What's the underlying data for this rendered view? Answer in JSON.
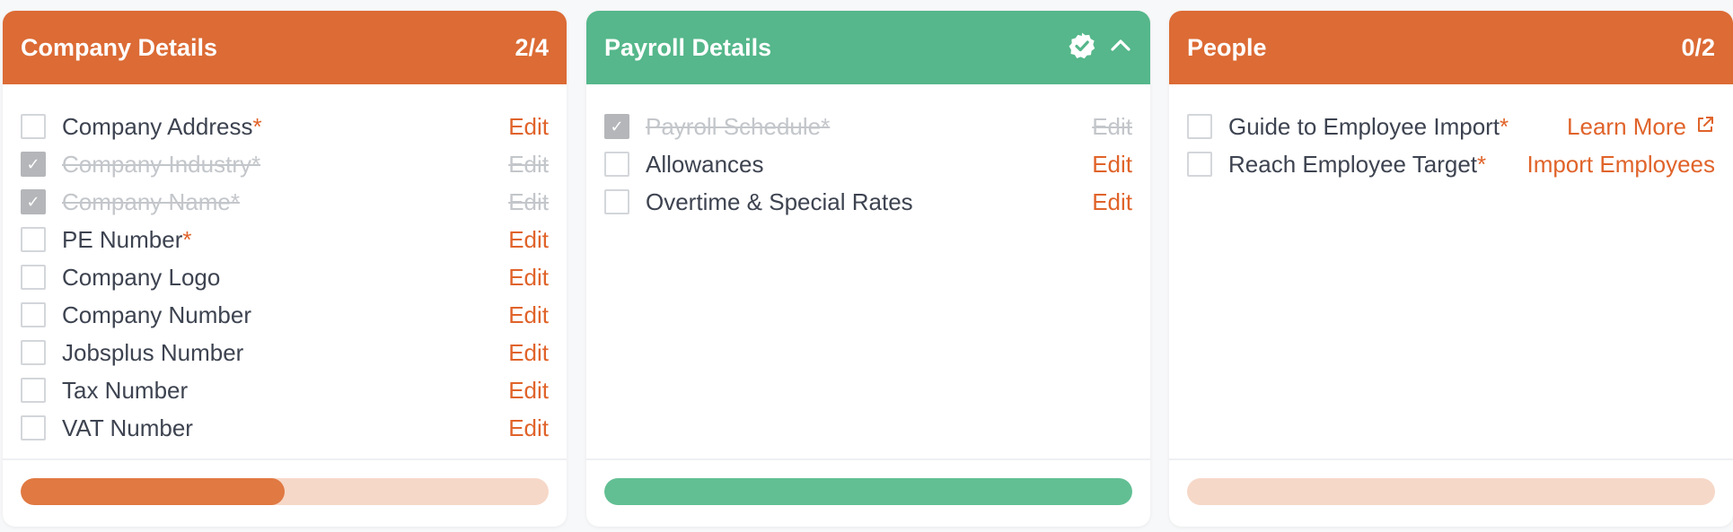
{
  "cards": [
    {
      "title": "Company Details",
      "count": "2/4",
      "progress_percent": 50,
      "items": [
        {
          "label": "Company Address",
          "required": "*",
          "action": "Edit",
          "done": false
        },
        {
          "label": "Company Industry",
          "required": "*",
          "action": "Edit",
          "done": true
        },
        {
          "label": "Company Name",
          "required": "*",
          "action": "Edit",
          "done": true
        },
        {
          "label": "PE Number",
          "required": "*",
          "action": "Edit",
          "done": false
        },
        {
          "label": "Company Logo",
          "required": "",
          "action": "Edit",
          "done": false
        },
        {
          "label": "Company Number",
          "required": "",
          "action": "Edit",
          "done": false
        },
        {
          "label": "Jobsplus Number",
          "required": "",
          "action": "Edit",
          "done": false
        },
        {
          "label": "Tax Number",
          "required": "",
          "action": "Edit",
          "done": false
        },
        {
          "label": "VAT Number",
          "required": "",
          "action": "Edit",
          "done": false
        }
      ]
    },
    {
      "title": "Payroll Details",
      "progress_percent": 100,
      "items": [
        {
          "label": "Payroll Schedule",
          "required": "*",
          "action": "Edit",
          "done": true
        },
        {
          "label": "Allowances",
          "required": "",
          "action": "Edit",
          "done": false
        },
        {
          "label": "Overtime & Special Rates",
          "required": "",
          "action": "Edit",
          "done": false
        }
      ]
    },
    {
      "title": "People",
      "count": "0/2",
      "progress_percent": 0,
      "items": [
        {
          "label": "Guide to Employee Import",
          "required": "*",
          "action": "Learn More",
          "done": false
        },
        {
          "label": "Reach Employee Target",
          "required": "*",
          "action": "Import Employees",
          "done": false
        }
      ]
    }
  ],
  "checkmark": "✓",
  "icons": {
    "verified": "verified-check-icon",
    "collapse": "chevron-up-icon",
    "external": "external-link-icon"
  },
  "colors": {
    "orange": "#dc6b35",
    "green": "#55b78b",
    "accent_text": "#e0632a"
  }
}
